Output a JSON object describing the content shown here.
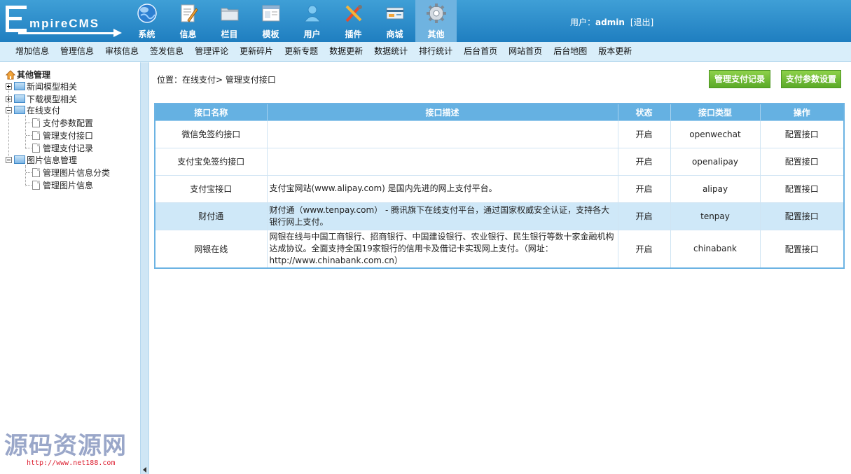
{
  "app": {
    "logo_text": "mpireCMS"
  },
  "topnav": [
    {
      "label": "系统",
      "icon": "globe-icon"
    },
    {
      "label": "信息",
      "icon": "document-pen-icon"
    },
    {
      "label": "栏目",
      "icon": "folder-icon"
    },
    {
      "label": "模板",
      "icon": "window-icon"
    },
    {
      "label": "用户",
      "icon": "user-icon"
    },
    {
      "label": "插件",
      "icon": "tools-icon"
    },
    {
      "label": "商城",
      "icon": "shop-card-icon"
    },
    {
      "label": "其他",
      "icon": "gear-icon",
      "active": true
    }
  ],
  "user": {
    "prefix": "用户：",
    "name": "admin",
    "logout": "[退出]"
  },
  "subnav": [
    "增加信息",
    "管理信息",
    "审核信息",
    "签发信息",
    "管理评论",
    "更新碎片",
    "更新专题",
    "数据更新",
    "数据统计",
    "排行统计",
    "后台首页",
    "网站首页",
    "后台地图",
    "版本更新"
  ],
  "sidebar": {
    "root": "其他管理",
    "groups": [
      {
        "label": "新闻模型相关",
        "expanded": false
      },
      {
        "label": "下载模型相关",
        "expanded": false
      },
      {
        "label": "在线支付",
        "expanded": true,
        "children": [
          "支付参数配置",
          "管理支付接口",
          "管理支付记录"
        ]
      },
      {
        "label": "图片信息管理",
        "expanded": true,
        "children": [
          "管理图片信息分类",
          "管理图片信息"
        ]
      }
    ]
  },
  "watermark": {
    "title": "源码资源网",
    "url": "http://www.net188.com"
  },
  "main": {
    "breadcrumb": "位置：在线支付> 管理支付接口",
    "btn_records": "管理支付记录",
    "btn_settings": "支付参数设置",
    "columns": [
      "接口名称",
      "接口描述",
      "状态",
      "接口类型",
      "操作"
    ],
    "rows": [
      {
        "name": "微信免签约接口",
        "desc": "",
        "status": "开启",
        "type": "openwechat",
        "op": "配置接口"
      },
      {
        "name": "支付宝免签约接口",
        "desc": "",
        "status": "开启",
        "type": "openalipay",
        "op": "配置接口"
      },
      {
        "name": "支付宝接口",
        "desc": "支付宝网站(www.alipay.com) 是国内先进的网上支付平台。",
        "status": "开启",
        "type": "alipay",
        "op": "配置接口"
      },
      {
        "name": "财付通",
        "desc": "财付通（www.tenpay.com） - 腾讯旗下在线支付平台，通过国家权威安全认证，支持各大银行网上支付。",
        "status": "开启",
        "type": "tenpay",
        "op": "配置接口"
      },
      {
        "name": "网银在线",
        "desc": "网银在线与中国工商银行、招商银行、中国建设银行、农业银行、民生银行等数十家金融机构达成协议。全面支持全国19家银行的信用卡及借记卡实现网上支付。（网址：http://www.chinabank.com.cn）",
        "status": "开启",
        "type": "chinabank",
        "op": "配置接口"
      }
    ]
  }
}
